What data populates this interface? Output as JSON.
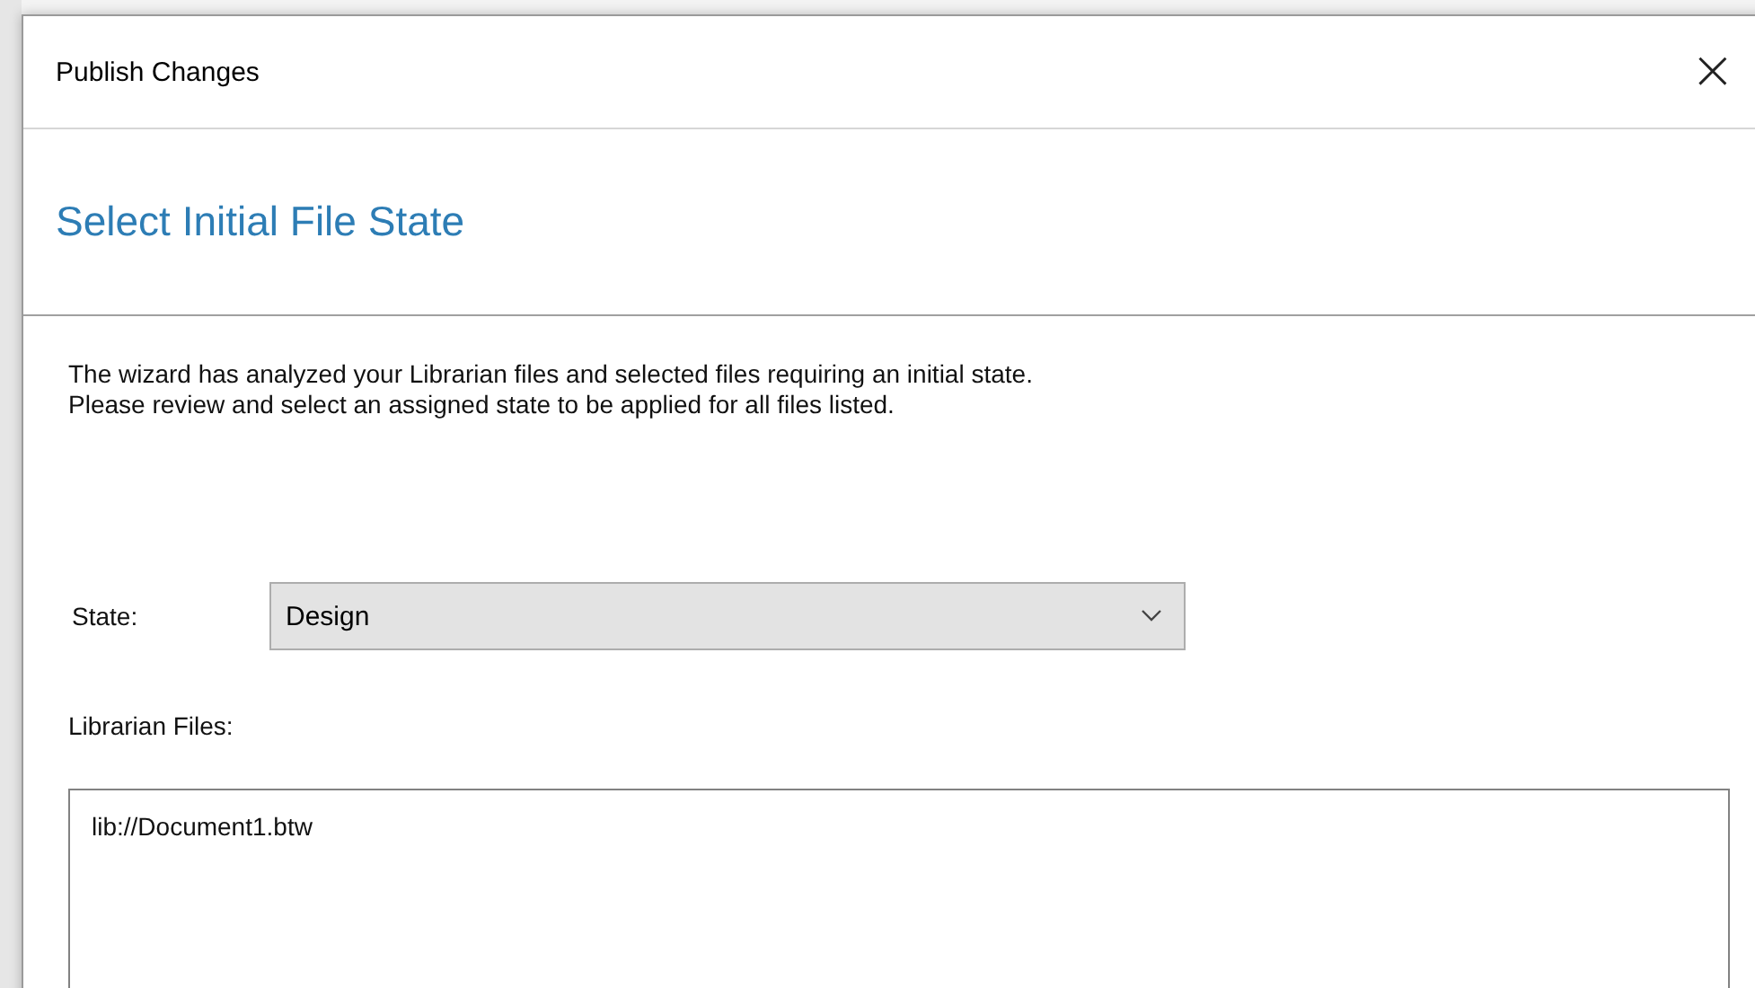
{
  "window": {
    "title": "Publish Changes",
    "close": "×"
  },
  "header": {
    "title": "Select Initial File State"
  },
  "description": [
    "The wizard has analyzed your Librarian files and selected files requiring an initial state.",
    "Please review and select an assigned state to be applied for all files listed."
  ],
  "state": {
    "label": "State:",
    "value": "Design"
  },
  "files": {
    "label": "Librarian Files:",
    "items": [
      "lib://Document1.btw"
    ]
  }
}
